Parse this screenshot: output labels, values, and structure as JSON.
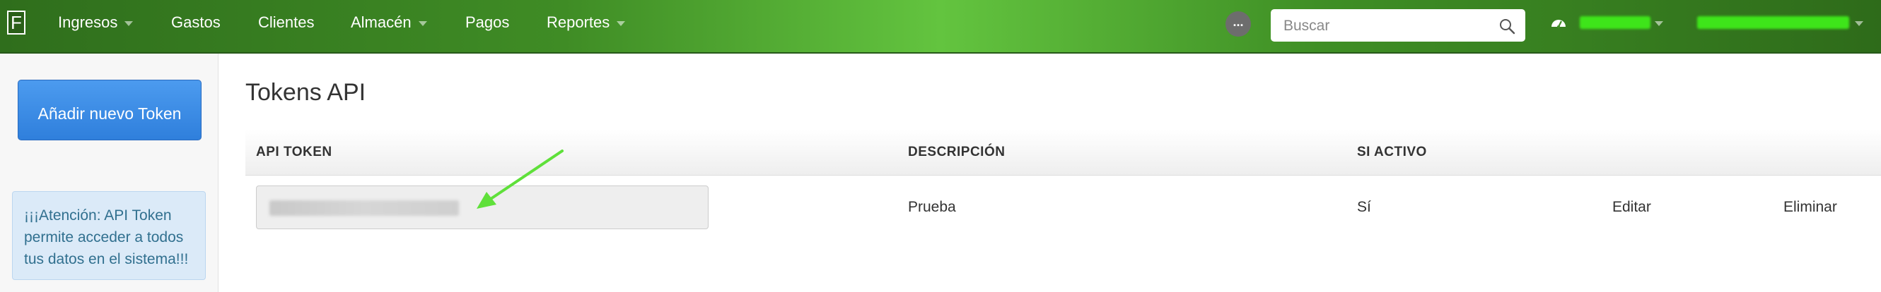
{
  "navbar": {
    "brand_letter": "F",
    "items": [
      {
        "label": "Ingresos",
        "has_caret": true
      },
      {
        "label": "Gastos",
        "has_caret": false
      },
      {
        "label": "Clientes",
        "has_caret": false
      },
      {
        "label": "Almacén",
        "has_caret": true
      },
      {
        "label": "Pagos",
        "has_caret": false
      },
      {
        "label": "Reportes",
        "has_caret": true
      }
    ],
    "more_label": "...",
    "search": {
      "placeholder": "Buscar",
      "value": ""
    },
    "dashboard_icon": "dashboard-gauge-icon",
    "company_name_redacted": "",
    "user_email_redacted": ""
  },
  "sidebar": {
    "add_button_label": "Añadir nuevo Token",
    "notice": "¡¡¡Atención: API Token permite acceder a todos tus datos en el sistema!!!"
  },
  "main": {
    "title": "Tokens API",
    "columns": [
      "API TOKEN",
      "DESCRIPCIÓN",
      "SI ACTIVO"
    ],
    "rows": [
      {
        "token_redacted": "",
        "description": "Prueba",
        "active": "Sí",
        "edit_label": "Editar",
        "delete_label": "Eliminar"
      }
    ]
  },
  "annotation": {
    "arrow_color": "#5fe03a"
  },
  "colors": {
    "navbar_green": "#3f8c25",
    "primary_button": "#3a87e0",
    "notice_bg": "#dbeaf8"
  }
}
